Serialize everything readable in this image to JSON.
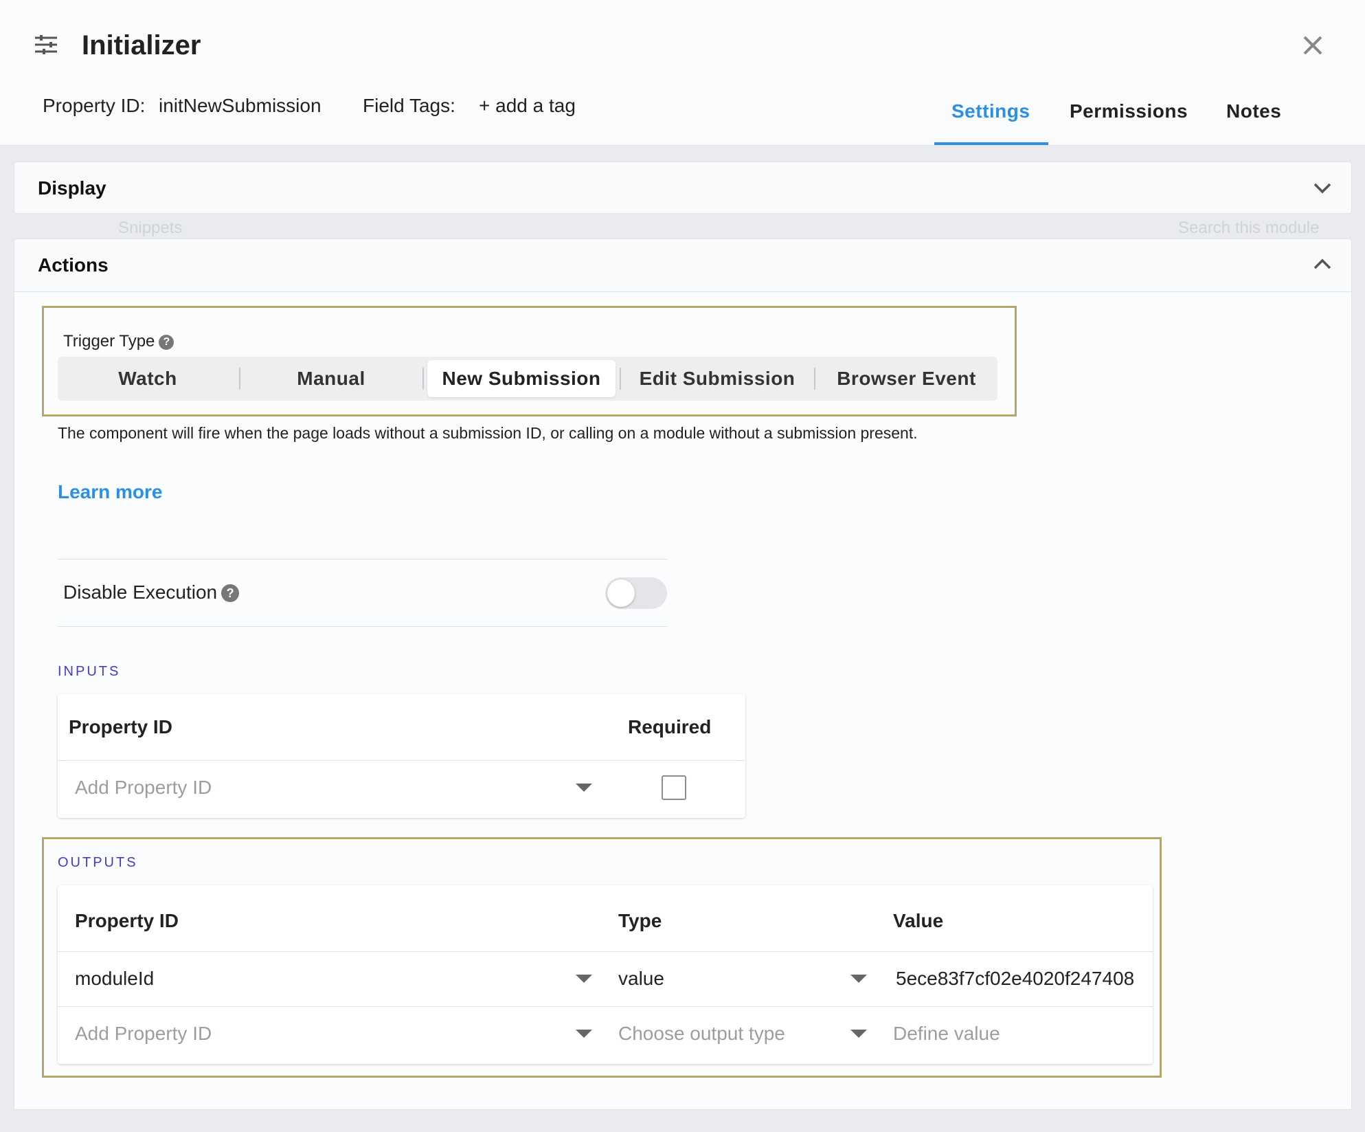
{
  "header": {
    "title": "Initializer",
    "property_id_label": "Property ID:",
    "property_id_value": "initNewSubmission",
    "field_tags_label": "Field Tags:",
    "add_tag": "+ add a tag",
    "tabs": [
      {
        "label": "Settings",
        "active": true
      },
      {
        "label": "Permissions",
        "active": false
      },
      {
        "label": "Notes",
        "active": false
      }
    ]
  },
  "background": {
    "ghost_snippets": "Snippets",
    "ghost_search": "Search this module"
  },
  "panels": {
    "display": {
      "title": "Display",
      "expanded": false
    },
    "actions": {
      "title": "Actions",
      "expanded": true
    }
  },
  "trigger": {
    "label": "Trigger Type",
    "options": [
      "Watch",
      "Manual",
      "New Submission",
      "Edit Submission",
      "Browser Event"
    ],
    "selected": "New Submission",
    "description": "The component will fire when the page loads without a submission ID, or calling on a module without a submission present.",
    "learn_more": "Learn more"
  },
  "disable_execution": {
    "label": "Disable Execution",
    "enabled": false
  },
  "inputs": {
    "title": "INPUTS",
    "columns": [
      "Property ID",
      "Required"
    ],
    "rows": [
      {
        "property_id_placeholder": "Add Property ID",
        "required": false
      }
    ]
  },
  "outputs": {
    "title": "OUTPUTS",
    "columns": [
      "Property ID",
      "Type",
      "Value"
    ],
    "rows": [
      {
        "property_id": "moduleId",
        "type": "value",
        "value": "5ece83f7cf02e4020f247408"
      }
    ],
    "new_row": {
      "property_id_placeholder": "Add Property ID",
      "type_placeholder": "Choose output type",
      "value_placeholder": "Define value"
    }
  },
  "colors": {
    "accent": "#2b8fe3",
    "highlight": "#b5a66a",
    "section_title": "#3e3ec8"
  }
}
